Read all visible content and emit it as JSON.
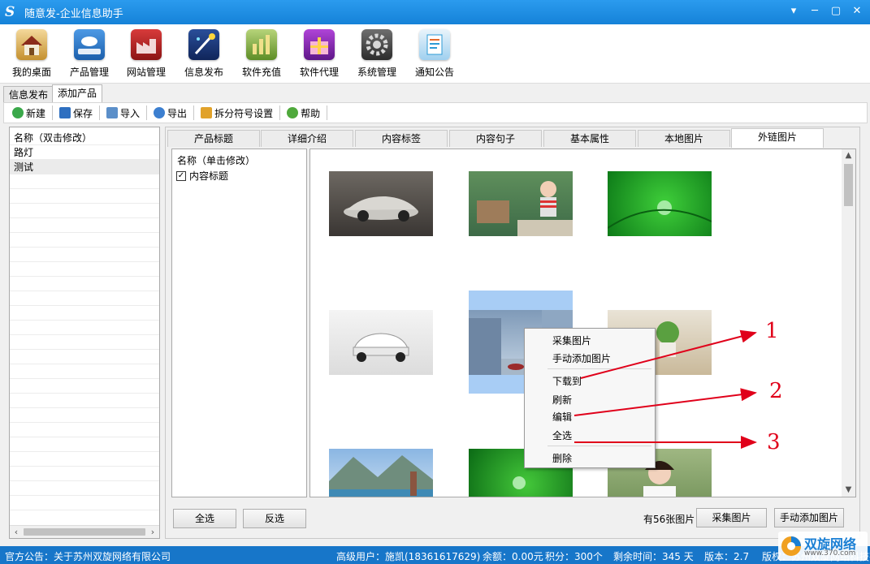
{
  "window": {
    "logo": "S",
    "title": "随意发-企业信息助手",
    "controls": [
      "▾",
      "─",
      "▢",
      "✕"
    ]
  },
  "main_toolbar": [
    {
      "label": "我的桌面",
      "icon": "house-icon",
      "color": "#3a6fb0"
    },
    {
      "label": "产品管理",
      "icon": "cloud-drive-icon",
      "color": "#2d74c4"
    },
    {
      "label": "网站管理",
      "icon": "factory-icon",
      "color": "#b51f1f"
    },
    {
      "label": "信息发布",
      "icon": "magic-wand-icon",
      "color": "#1d3c8c"
    },
    {
      "label": "软件充值",
      "icon": "money-chart-icon",
      "color": "#6aa334"
    },
    {
      "label": "软件代理",
      "icon": "gift-box-icon",
      "color": "#8a2fb8"
    },
    {
      "label": "系统管理",
      "icon": "gear-icon",
      "color": "#444444"
    },
    {
      "label": "通知公告",
      "icon": "notes-icon",
      "color": "#2e9bd6"
    }
  ],
  "doc_tabs": [
    "信息发布",
    "添加产品"
  ],
  "sub_toolbar": [
    {
      "label": "新建",
      "icon": "plus-circle-icon"
    },
    {
      "label": "保存",
      "icon": "save-icon"
    },
    {
      "label": "导入",
      "icon": "import-icon"
    },
    {
      "label": "导出",
      "icon": "export-icon"
    },
    {
      "label": "拆分符号设置",
      "icon": "up-arrow-icon"
    },
    {
      "label": "帮助",
      "icon": "help-icon"
    }
  ],
  "left_list": {
    "header": "名称（双击修改）",
    "items": [
      "路灯",
      "测试"
    ]
  },
  "content_tabs": [
    "产品标题",
    "详细介绍",
    "内容标签",
    "内容句子",
    "基本属性",
    "本地图片",
    "外链图片"
  ],
  "field_panel": {
    "header": "名称（单击修改）",
    "items": [
      {
        "label": "内容标题",
        "checked": true
      }
    ]
  },
  "context_menu": [
    "采集图片",
    "手动添加图片",
    "下载到",
    "刷新",
    "编辑",
    "全选",
    "删除"
  ],
  "annotations": [
    "1",
    "2",
    "3"
  ],
  "bottom": {
    "select_all": "全选",
    "invert": "反选",
    "count_text": "有56张图片",
    "collect": "采集图片",
    "manual_add": "手动添加图片"
  },
  "status": {
    "notice": "官方公告：关于苏州双旋网络有限公司",
    "user": "高级用户：施凯(18361617629)",
    "balance": "余额：0.00元",
    "points": "积分：300个",
    "remaining": "剩余时间：345 天",
    "version": "版本：2.7",
    "copyright": "版权：苏州双旋网络科技有限",
    "watermark": "双旋网络",
    "watermark_url": "www.370.com"
  }
}
